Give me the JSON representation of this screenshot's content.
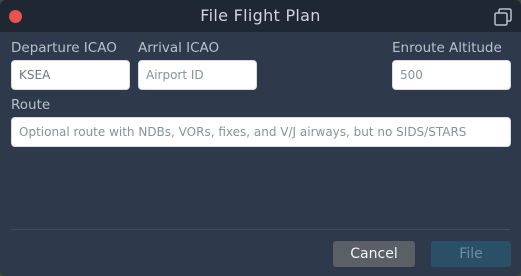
{
  "window": {
    "title": "File Flight Plan",
    "icons": {
      "close": "close-dot",
      "popout": "popout-window-icon"
    }
  },
  "form": {
    "departure": {
      "label": "Departure ICAO",
      "value": "KSEA",
      "placeholder": ""
    },
    "arrival": {
      "label": "Arrival ICAO",
      "value": "",
      "placeholder": "Airport ID"
    },
    "altitude": {
      "label": "Enroute Altitude",
      "value": "",
      "placeholder": "500"
    },
    "route": {
      "label": "Route",
      "value": "",
      "placeholder": "Optional route with NDBs, VORs, fixes, and V/J airways, but no SIDS/STARS"
    }
  },
  "buttons": {
    "cancel": "Cancel",
    "file": "File"
  },
  "colors": {
    "window_bg": "#2e3a4c",
    "titlebar_bg": "#1f2733",
    "close": "#e8524f",
    "cancel_bg": "#5b5f66",
    "file_bg_disabled": "#2a5068"
  }
}
